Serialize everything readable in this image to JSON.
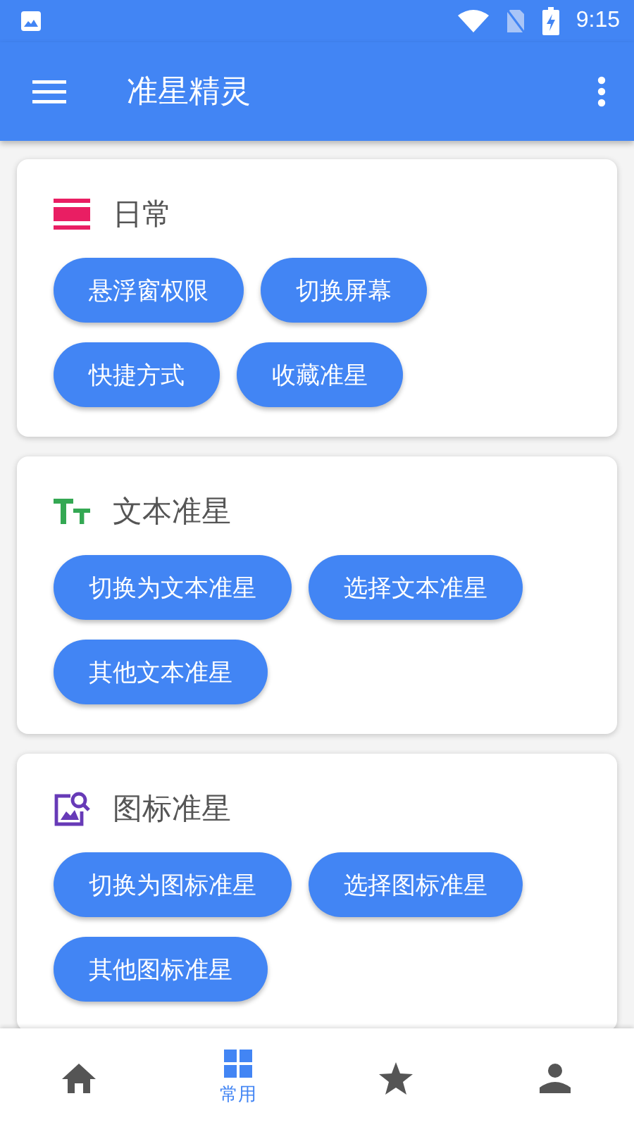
{
  "status_bar": {
    "time": "9:15"
  },
  "app_bar": {
    "title": "准星精灵"
  },
  "sections": [
    {
      "kind": "daily",
      "title": "日常",
      "buttons": [
        "悬浮窗权限",
        "切换屏幕",
        "快捷方式",
        "收藏准星"
      ]
    },
    {
      "kind": "text",
      "title": "文本准星",
      "buttons": [
        "切换为文本准星",
        "选择文本准星",
        "其他文本准星"
      ]
    },
    {
      "kind": "icon",
      "title": "图标准星",
      "buttons": [
        "切换为图标准星",
        "选择图标准星",
        "其他图标准星"
      ]
    }
  ],
  "bottom_nav": [
    {
      "kind": "home",
      "selected": false
    },
    {
      "kind": "common",
      "label": "常用",
      "selected": true
    },
    {
      "kind": "star",
      "selected": false
    },
    {
      "kind": "person",
      "selected": false
    }
  ]
}
